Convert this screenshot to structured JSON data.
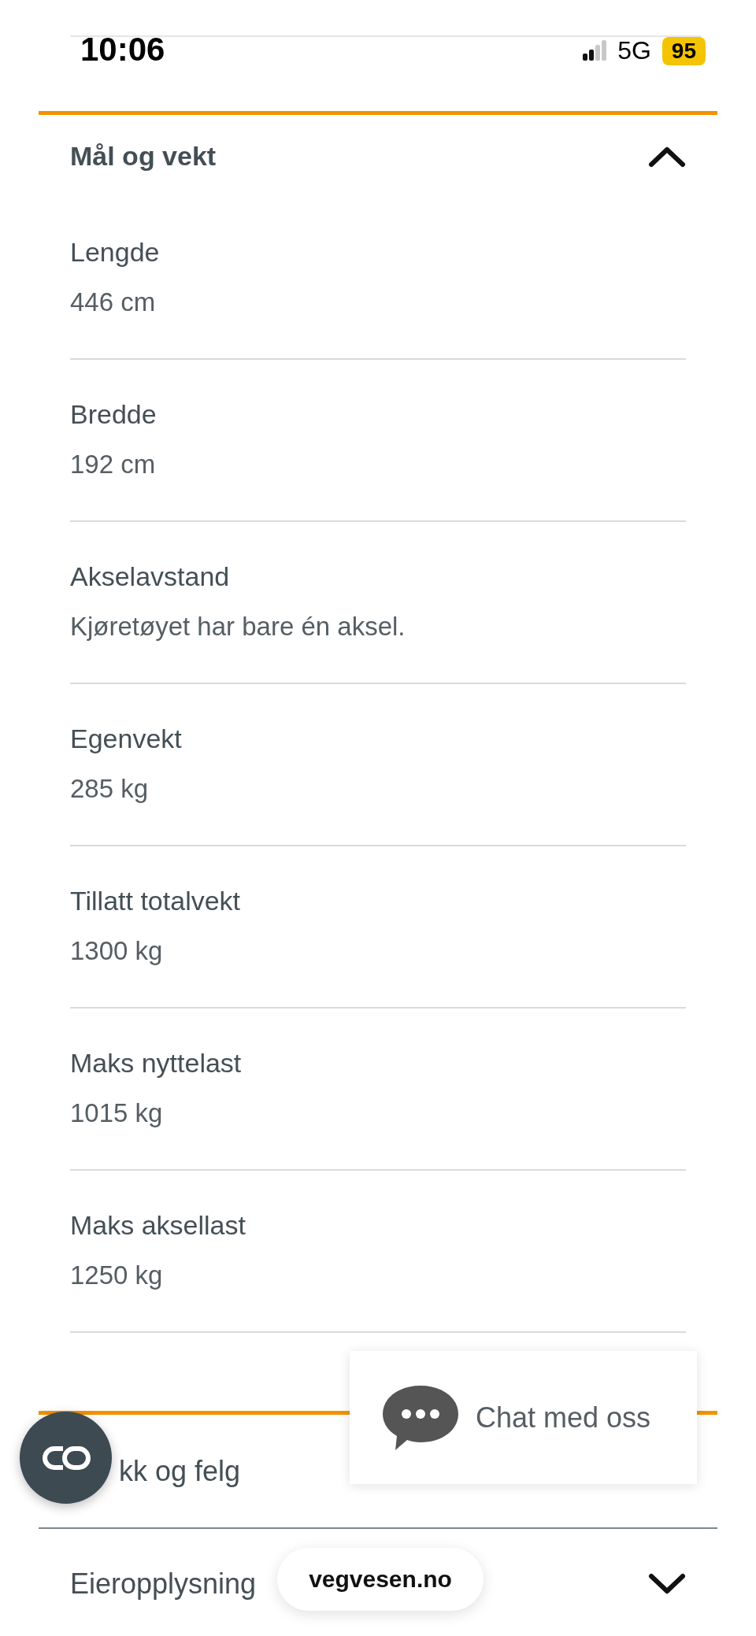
{
  "status_bar": {
    "time": "10:06",
    "network": "5G",
    "battery": "95"
  },
  "sections": [
    {
      "title": "Mål og vekt",
      "expanded": true,
      "fields": [
        {
          "label": "Lengde",
          "value": "446 cm"
        },
        {
          "label": "Bredde",
          "value": "192 cm"
        },
        {
          "label": "Akselavstand",
          "value": "Kjøretøyet har bare én aksel."
        },
        {
          "label": "Egenvekt",
          "value": "285 kg"
        },
        {
          "label": "Tillatt totalvekt",
          "value": "1300 kg"
        },
        {
          "label": "Maks nyttelast",
          "value": "1015 kg"
        },
        {
          "label": "Maks aksellast",
          "value": "1250 kg"
        }
      ]
    },
    {
      "title": "kk og felg"
    },
    {
      "title": "Eieropplysning",
      "expanded": false
    }
  ],
  "chat": {
    "label": "Chat med oss"
  },
  "url_bar": {
    "address": "vegvesen.no"
  }
}
